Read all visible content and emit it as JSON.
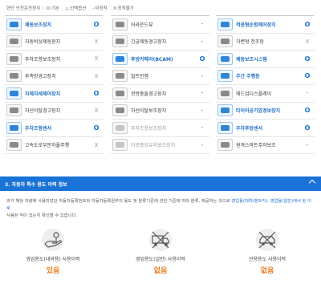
{
  "legend": {
    "items": [
      "현단 안전운전장치",
      "기본",
      "선택옵션",
      "미장착",
      "장착불가"
    ],
    "marks": [
      "",
      "O",
      "△",
      "-",
      "X"
    ]
  },
  "features": {
    "col1": [
      {
        "label": "제동보조장치",
        "mark": "O",
        "style": "on"
      },
      {
        "label": "자동비상제동장치",
        "mark": "X",
        "style": "normal"
      },
      {
        "label": "주차조향보조장치",
        "mark": "X",
        "style": "normal"
      },
      {
        "label": "후측방경고장치",
        "mark": "X",
        "style": "normal"
      },
      {
        "label": "차체자세제어장치",
        "mark": "O",
        "style": "on"
      },
      {
        "label": "차선이탈경고장치",
        "mark": "X",
        "style": "normal"
      },
      {
        "label": "주차조향센서",
        "mark": "O",
        "style": "on"
      },
      {
        "label": "고속도로부분자율주행",
        "mark": "X",
        "style": "normal"
      }
    ],
    "col2": [
      {
        "label": "어라운드뷰",
        "mark": "-",
        "style": "normal"
      },
      {
        "label": "긴급제동경고장치",
        "mark": "-",
        "style": "normal"
      },
      {
        "label": "후방카메라(BCAM)",
        "mark": "O",
        "style": "on"
      },
      {
        "label": "빌트인캠",
        "mark": "-",
        "style": "normal"
      },
      {
        "label": "전방충돌경고장치",
        "mark": "-",
        "style": "normal"
      },
      {
        "label": "차선이탈보조장치",
        "mark": "-",
        "style": "normal"
      },
      {
        "label": "주차조향보조장치",
        "mark": "-",
        "style": "dim"
      },
      {
        "label": "차로중앙유지보조장치",
        "mark": "-",
        "style": "dim"
      }
    ],
    "col3": [
      {
        "label": "적응형순항제어장치",
        "mark": "O",
        "style": "on"
      },
      {
        "label": "가변형 전조등",
        "mark": "X",
        "style": "normal"
      },
      {
        "label": "제동보조시스템",
        "mark": "O",
        "style": "on"
      },
      {
        "label": "주간 주행등",
        "mark": "O",
        "style": "on"
      },
      {
        "label": "헤드업디스플레이",
        "mark": "-",
        "style": "normal"
      },
      {
        "label": "타이어공기압경보장치",
        "mark": "O",
        "style": "on"
      },
      {
        "label": "주차후방센서",
        "mark": "O",
        "style": "on"
      },
      {
        "label": "원격스마트주차보조",
        "mark": "-",
        "style": "normal"
      }
    ]
  },
  "section": {
    "title": "3. 자동차 특수 용도 이력 정보"
  },
  "description": {
    "text1": "과거 해당 차량에 사용되었던 자동차등록번호와 자동차등록원부의 용도 및 분류기준에 관한 기준에 따라 분류, 제공하는 것으로 ",
    "highlight": "영업용(대여/렌트카), 영업용(일반)에서 된 이로",
    "text2": "사용된 적이 있는지 확인할 수 있습니다."
  },
  "uses": [
    {
      "label": "영업용도(대여용) 사용이력",
      "value": "있음",
      "icon": "hand-key-icon"
    },
    {
      "label": "영업용도(일반) 사용이력",
      "value": "없음",
      "icon": "truck-crossed-icon"
    },
    {
      "label": "관용용도 사용이력",
      "value": "없음",
      "icon": "car-crossed-icon"
    }
  ],
  "colors": {
    "accent": "#1a73d6",
    "highlight_text": "#1a6fd1",
    "result_orange": "#ec7a1c"
  }
}
